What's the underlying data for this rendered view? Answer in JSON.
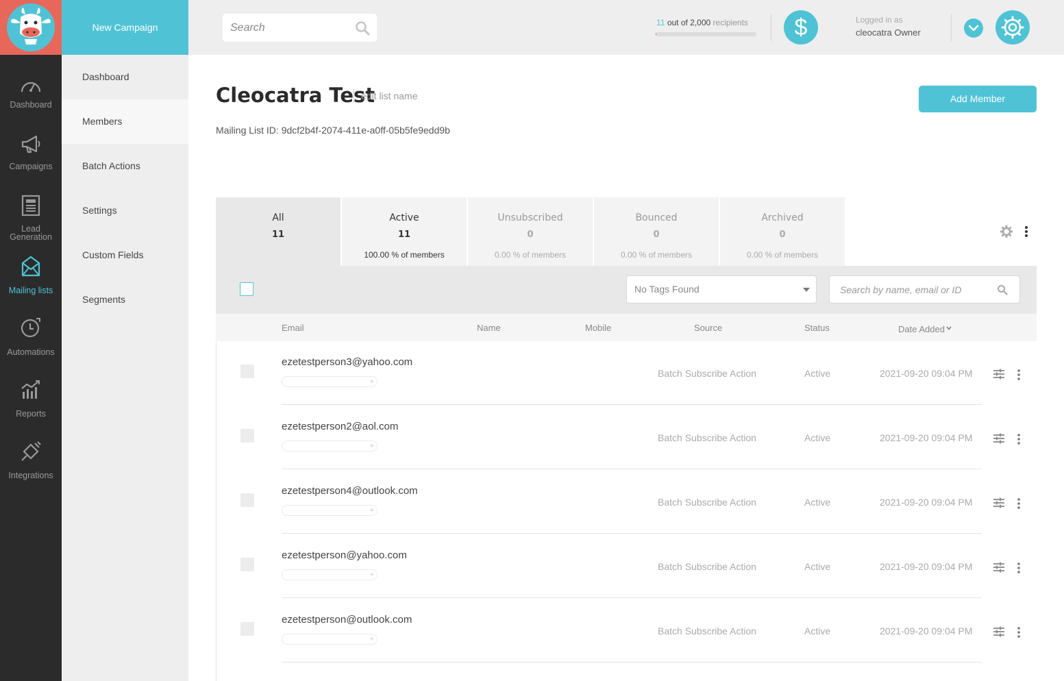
{
  "brand": {
    "accent": "#4fc3d5",
    "logo_bg": "#e8675b",
    "rail_bg": "#2b2b2b"
  },
  "rail": {
    "items": [
      {
        "label": "Dashboard",
        "icon": "speedometer-icon"
      },
      {
        "label": "Campaigns",
        "icon": "megaphone-icon"
      },
      {
        "label": "Lead\nGeneration",
        "label_l1": "Lead",
        "label_l2": "Generation",
        "icon": "form-icon"
      },
      {
        "label": "Mailing lists",
        "icon": "envelope-icon",
        "active": true
      },
      {
        "label": "Automations",
        "icon": "clock-icon"
      },
      {
        "label": "Reports",
        "icon": "bar-chart-icon"
      },
      {
        "label": "Integrations",
        "icon": "plug-icon"
      }
    ]
  },
  "sidebar": {
    "new_campaign": "New Campaign",
    "items": [
      {
        "label": "Dashboard"
      },
      {
        "label": "Members",
        "active": true
      },
      {
        "label": "Batch Actions"
      },
      {
        "label": "Settings"
      },
      {
        "label": "Custom Fields"
      },
      {
        "label": "Segments"
      }
    ]
  },
  "header": {
    "search_placeholder": "Search",
    "quota": {
      "used": "11",
      "middle": "out of 2,000",
      "suffix": "recipients",
      "fraction": 0.0055
    },
    "billing_symbol": "$",
    "logged_in_label": "Logged in as",
    "user_name": "cleocatra Owner"
  },
  "list": {
    "title": "Cleocatra Test",
    "edit_label": "edit list name",
    "id_text": "Mailing List ID: 9dcf2b4f-2074-411e-a0ff-05b5fe9edd9b",
    "add_member_label": "Add Member"
  },
  "stat_tabs": [
    {
      "label": "All",
      "count": "11",
      "pct": ""
    },
    {
      "label": "Active",
      "count": "11",
      "pct": "100.00 % of members"
    },
    {
      "label": "Unsubscribed",
      "count": "0",
      "pct": "0.00 % of members"
    },
    {
      "label": "Bounced",
      "count": "0",
      "pct": "0.00 % of members"
    },
    {
      "label": "Archived",
      "count": "0",
      "pct": "0.00 % of members"
    }
  ],
  "filters": {
    "tags_value": "No Tags Found",
    "search_placeholder": "Search by name, email or ID"
  },
  "table": {
    "columns": {
      "email": "Email",
      "name": "Name",
      "mobile": "Mobile",
      "source": "Source",
      "status": "Status",
      "date": "Date Added"
    },
    "rows": [
      {
        "email": "ezetestperson3@yahoo.com",
        "source": "Batch Subscribe Action",
        "status": "Active",
        "date": "2021-09-20 09:04 PM"
      },
      {
        "email": "ezetestperson2@aol.com",
        "source": "Batch Subscribe Action",
        "status": "Active",
        "date": "2021-09-20 09:04 PM"
      },
      {
        "email": "ezetestperson4@outlook.com",
        "source": "Batch Subscribe Action",
        "status": "Active",
        "date": "2021-09-20 09:04 PM"
      },
      {
        "email": "ezetestperson@yahoo.com",
        "source": "Batch Subscribe Action",
        "status": "Active",
        "date": "2021-09-20 09:04 PM"
      },
      {
        "email": "ezetestperson@outlook.com",
        "source": "Batch Subscribe Action",
        "status": "Active",
        "date": "2021-09-20 09:04 PM"
      }
    ]
  }
}
